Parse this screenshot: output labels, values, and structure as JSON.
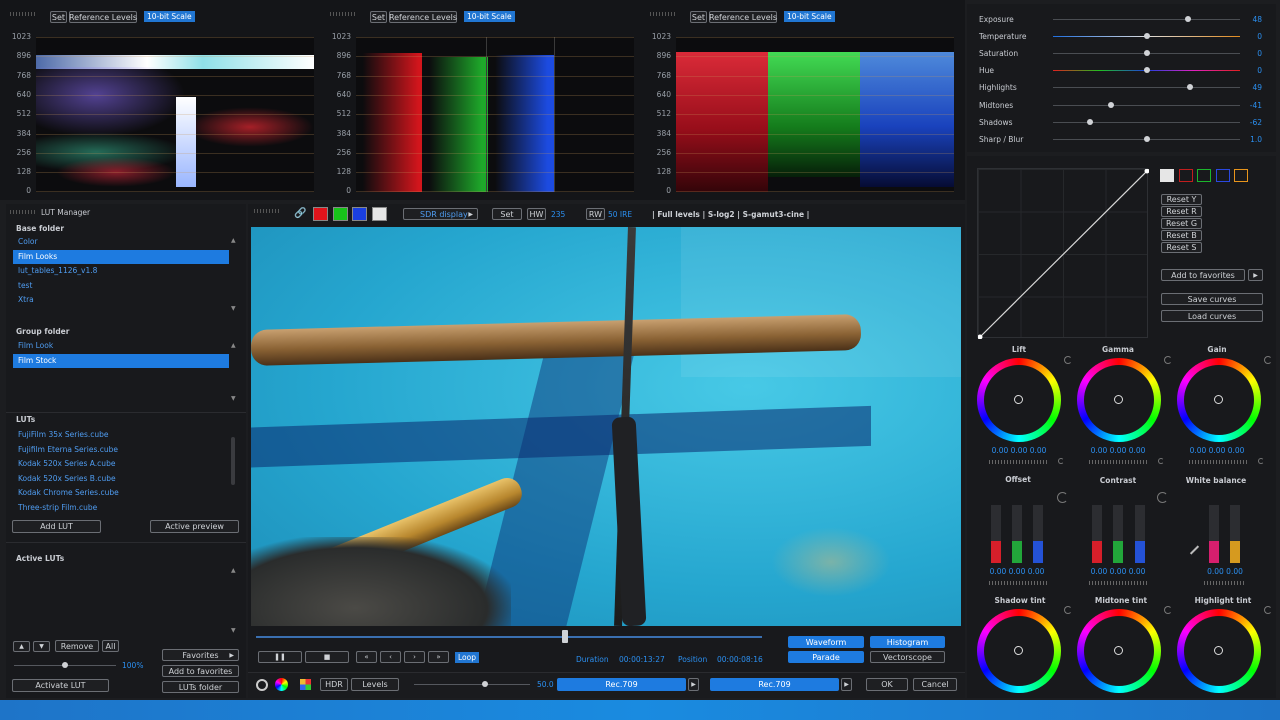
{
  "scopes": {
    "header": [
      {
        "set": "Set",
        "ref": "Reference Levels",
        "scale": "10-bit Scale"
      },
      {
        "set": "Set",
        "ref": "Reference Levels",
        "scale": "10-bit Scale"
      },
      {
        "set": "Set",
        "ref": "Reference Levels",
        "scale": "10-bit Scale"
      }
    ],
    "levels": [
      "1023",
      "896",
      "768",
      "640",
      "512",
      "384",
      "256",
      "128",
      "0"
    ]
  },
  "lut_manager": {
    "title": "LUT Manager",
    "base_folder_label": "Base folder",
    "base_folders": [
      "Color",
      "Film Looks",
      "lut_tables_1126_v1.8",
      "test",
      "Xtra"
    ],
    "group_folder_label": "Group folder",
    "group_folders": [
      "Film Look",
      "Film Stock"
    ],
    "luts_label": "LUTs",
    "luts": [
      "FujiFilm 35x Series.cube",
      "Fujifilm Eterna Series.cube",
      "Kodak 520x Series A.cube",
      "Kodak 520x Series B.cube",
      "Kodak Chrome Series.cube",
      "Three-strip Film.cube"
    ],
    "add_lut": "Add LUT",
    "active_preview": "Active preview",
    "active_luts_label": "Active LUTs",
    "remove": "Remove",
    "all": "All",
    "opacity": "100%",
    "favorites": "Favorites",
    "add_to_favorites": "Add to favorites",
    "luts_folder": "LUTs folder",
    "activate_lut": "Activate LUT"
  },
  "viewer_toolbar": {
    "display": "SDR display",
    "set": "Set",
    "hw": "HW",
    "hw_value": "235",
    "rw": "RW",
    "rw_value": "50 IRE",
    "info": "| Full levels | S-log2 | S-gamut3-cine |",
    "swatches": [
      "#e0141c",
      "#18c21a",
      "#1a3fe0",
      "#e6e6e6"
    ]
  },
  "transport": {
    "loop": "Loop",
    "duration_label": "Duration",
    "duration": "00:00:13:27",
    "position_label": "Position",
    "position": "00:00:08:16",
    "waveform": "Waveform",
    "histogram": "Histogram",
    "parade": "Parade",
    "vectorscope": "Vectorscope",
    "hdr": "HDR",
    "levels": "Levels",
    "nits": "50.0",
    "rec_in": "Rec.709",
    "rec_out": "Rec.709",
    "ok": "OK",
    "cancel": "Cancel"
  },
  "adjust": {
    "sliders": [
      {
        "label": "Exposure",
        "value": "48",
        "pos": 0.72,
        "color": "#4a4d52"
      },
      {
        "label": "Temperature",
        "value": "0",
        "pos": 0.5,
        "color": "temp"
      },
      {
        "label": "Saturation",
        "value": "0",
        "pos": 0.5,
        "color": "#4a4d52"
      },
      {
        "label": "Hue",
        "value": "0",
        "pos": 0.5,
        "color": "hue"
      },
      {
        "label": "Highlights",
        "value": "49",
        "pos": 0.73,
        "color": "#4a4d52"
      },
      {
        "label": "Midtones",
        "value": "-41",
        "pos": 0.31,
        "color": "#4a4d52"
      },
      {
        "label": "Shadows",
        "value": "-62",
        "pos": 0.2,
        "color": "#4a4d52"
      },
      {
        "label": "Sharp / Blur",
        "value": "1.0",
        "pos": 0.5,
        "color": "#4a4d52"
      }
    ]
  },
  "curves": {
    "channels": [
      "#e6e6e6",
      "#c21e1e",
      "#1bb52c",
      "#2a48e0",
      "#e8951c"
    ],
    "reset_y": "Reset Y",
    "reset_r": "Reset R",
    "reset_g": "Reset G",
    "reset_b": "Reset B",
    "reset_s": "Reset S",
    "add_to_favorites": "Add to favorites",
    "save_curves": "Save curves",
    "load_curves": "Load curves"
  },
  "wheels": {
    "lift": "Lift",
    "gamma": "Gamma",
    "gain": "Gain",
    "lift_vals": "0.00  0.00  0.00",
    "gamma_vals": "0.00  0.00  0.00",
    "gain_vals": "0.00  0.00  0.00",
    "offset": "Offset",
    "contrast": "Contrast",
    "white_balance": "White balance",
    "offset_vals": "0.00  0.00  0.00",
    "contrast_vals": "0.00  0.00  0.00",
    "wb_vals": "0.00    0.00",
    "shadow_tint": "Shadow tint",
    "midtone_tint": "Midtone tint",
    "highlight_tint": "Highlight tint"
  }
}
